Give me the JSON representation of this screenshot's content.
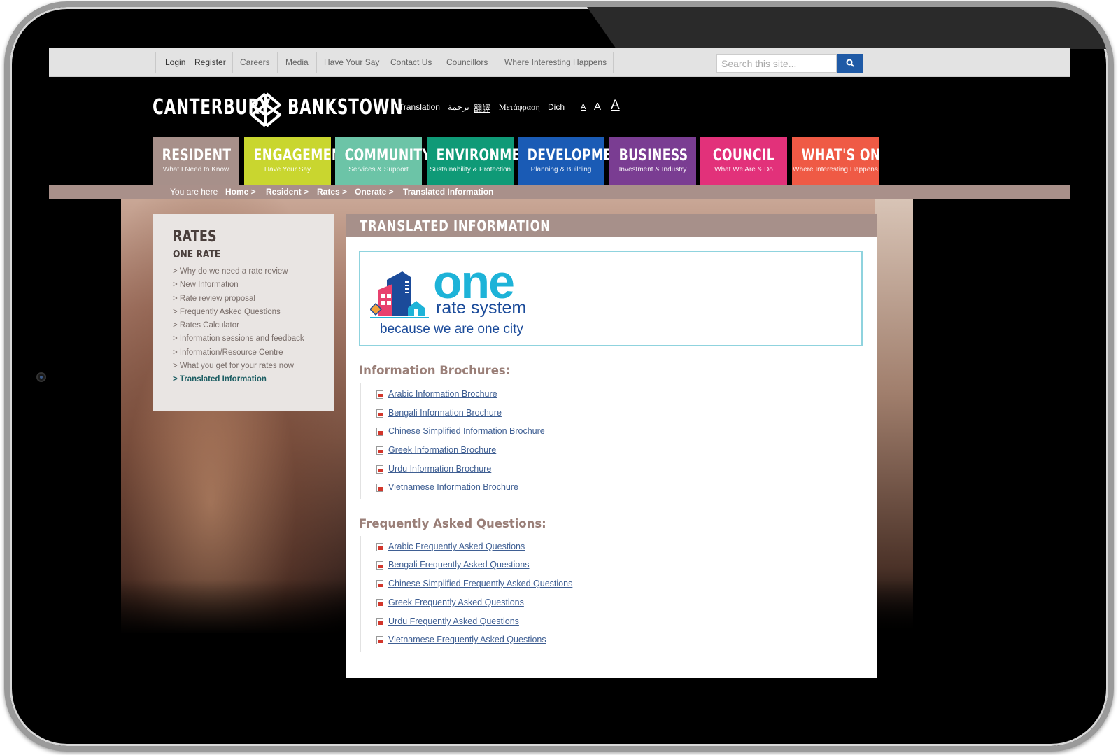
{
  "utility_bar": {
    "login": "Login",
    "register": "Register",
    "links": [
      "Careers",
      "Media",
      "Have Your Say",
      "Contact Us",
      "Councillors",
      "Where Interesting Happens"
    ],
    "search_placeholder": "Search this site..."
  },
  "header": {
    "logo_left": "CANTERBURY",
    "logo_right": "BANKSTOWN",
    "language_links": [
      "Translation",
      "ترجمة",
      "翻譯",
      "Μετάφραση",
      "Dịch"
    ],
    "font_sizes": [
      "A",
      "A",
      "A"
    ]
  },
  "nav": [
    {
      "title": "RESIDENT",
      "subtitle": "What I Need to Know",
      "color": "#a7908a"
    },
    {
      "title": "ENGAGEMENT",
      "subtitle": "Have Your Say",
      "color": "#c9d62f"
    },
    {
      "title": "COMMUNITY",
      "subtitle": "Services & Support",
      "color": "#6cc4a7"
    },
    {
      "title": "ENVIRONMENT",
      "subtitle": "Sustainability & Protection",
      "color": "#0f9a77"
    },
    {
      "title": "DEVELOPMENT",
      "subtitle": "Planning & Building",
      "color": "#1a5bb5"
    },
    {
      "title": "BUSINESS",
      "subtitle": "Investment & Industry",
      "color": "#7a3d92"
    },
    {
      "title": "COUNCIL",
      "subtitle": "What We Are & Do",
      "color": "#e2317a"
    },
    {
      "title": "WHAT'S ON",
      "subtitle": "Where Interesting Happens",
      "color": "#ef5a45"
    }
  ],
  "breadcrumb": {
    "prefix": "You are here",
    "items": [
      "Home >",
      "Resident >",
      "Rates >",
      "Onerate >",
      "Translated Information"
    ]
  },
  "sidebar": {
    "title": "RATES",
    "subtitle": "ONE RATE",
    "items": [
      "> Why do we need a rate review",
      "> New Information",
      "> Rate review proposal",
      "> Frequently Asked Questions",
      "> Rates Calculator",
      "> Information sessions and feedback",
      "> Information/Resource Centre",
      "> What you get for your rates now",
      "> Translated Information"
    ],
    "active_index": 8
  },
  "main": {
    "title": "TRANSLATED INFORMATION",
    "banner": {
      "one": "one",
      "rate_system": "rate system",
      "tagline": "because we are one city"
    },
    "brochures_heading": "Information Brochures:",
    "brochures": [
      "Arabic Information Brochure",
      "Bengali Information Brochure",
      "Chinese Simplified Information Brochure",
      "Greek Information Brochure",
      "Urdu Information Brochure",
      "Vietnamese Information Brochure"
    ],
    "faq_heading": "Frequently Asked Questions:",
    "faqs": [
      "Arabic Frequently Asked Questions",
      "Bengali Frequently Asked Questions",
      "Chinese Simplified Frequently Asked Questions",
      "Greek Frequently Asked Questions",
      "Urdu Frequently Asked Questions",
      "Vietnamese Frequently Asked Questions"
    ]
  },
  "icons": {
    "search": "search-icon",
    "pdf": "pdf-icon",
    "camera": "camera-icon"
  }
}
